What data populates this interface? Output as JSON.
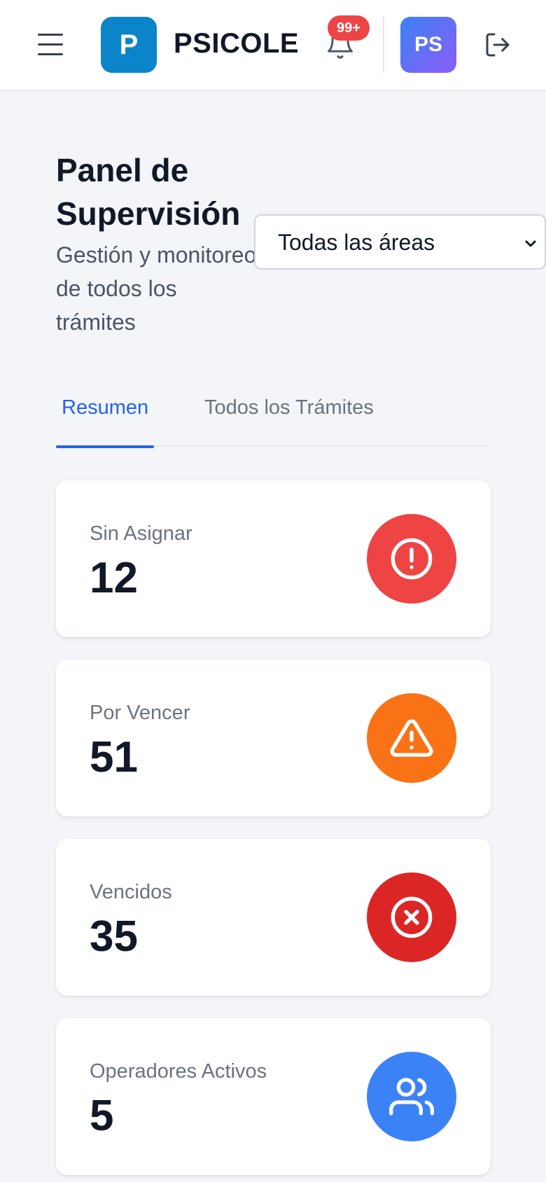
{
  "header": {
    "logo_letter": "P",
    "brand": "PSICOLE",
    "notifications_badge": "99+",
    "avatar_initials": "PS"
  },
  "page": {
    "title": "Panel de Supervisión",
    "subtitle": "Gestión y monitoreo de todos los trámites"
  },
  "filter": {
    "selected": "Todas las áreas"
  },
  "tabs": [
    {
      "label": "Resumen",
      "active": true
    },
    {
      "label": "Todos los Trámites",
      "active": false
    }
  ],
  "stats": [
    {
      "label": "Sin Asignar",
      "value": "12",
      "icon": "alert-circle-icon",
      "color": "#ef4444"
    },
    {
      "label": "Por Vencer",
      "value": "51",
      "icon": "warning-triangle-icon",
      "color": "#f97316"
    },
    {
      "label": "Vencidos",
      "value": "35",
      "icon": "x-circle-icon",
      "color": "#dc2626"
    },
    {
      "label": "Operadores Activos",
      "value": "5",
      "icon": "users-icon",
      "color": "#3b82f6"
    }
  ]
}
